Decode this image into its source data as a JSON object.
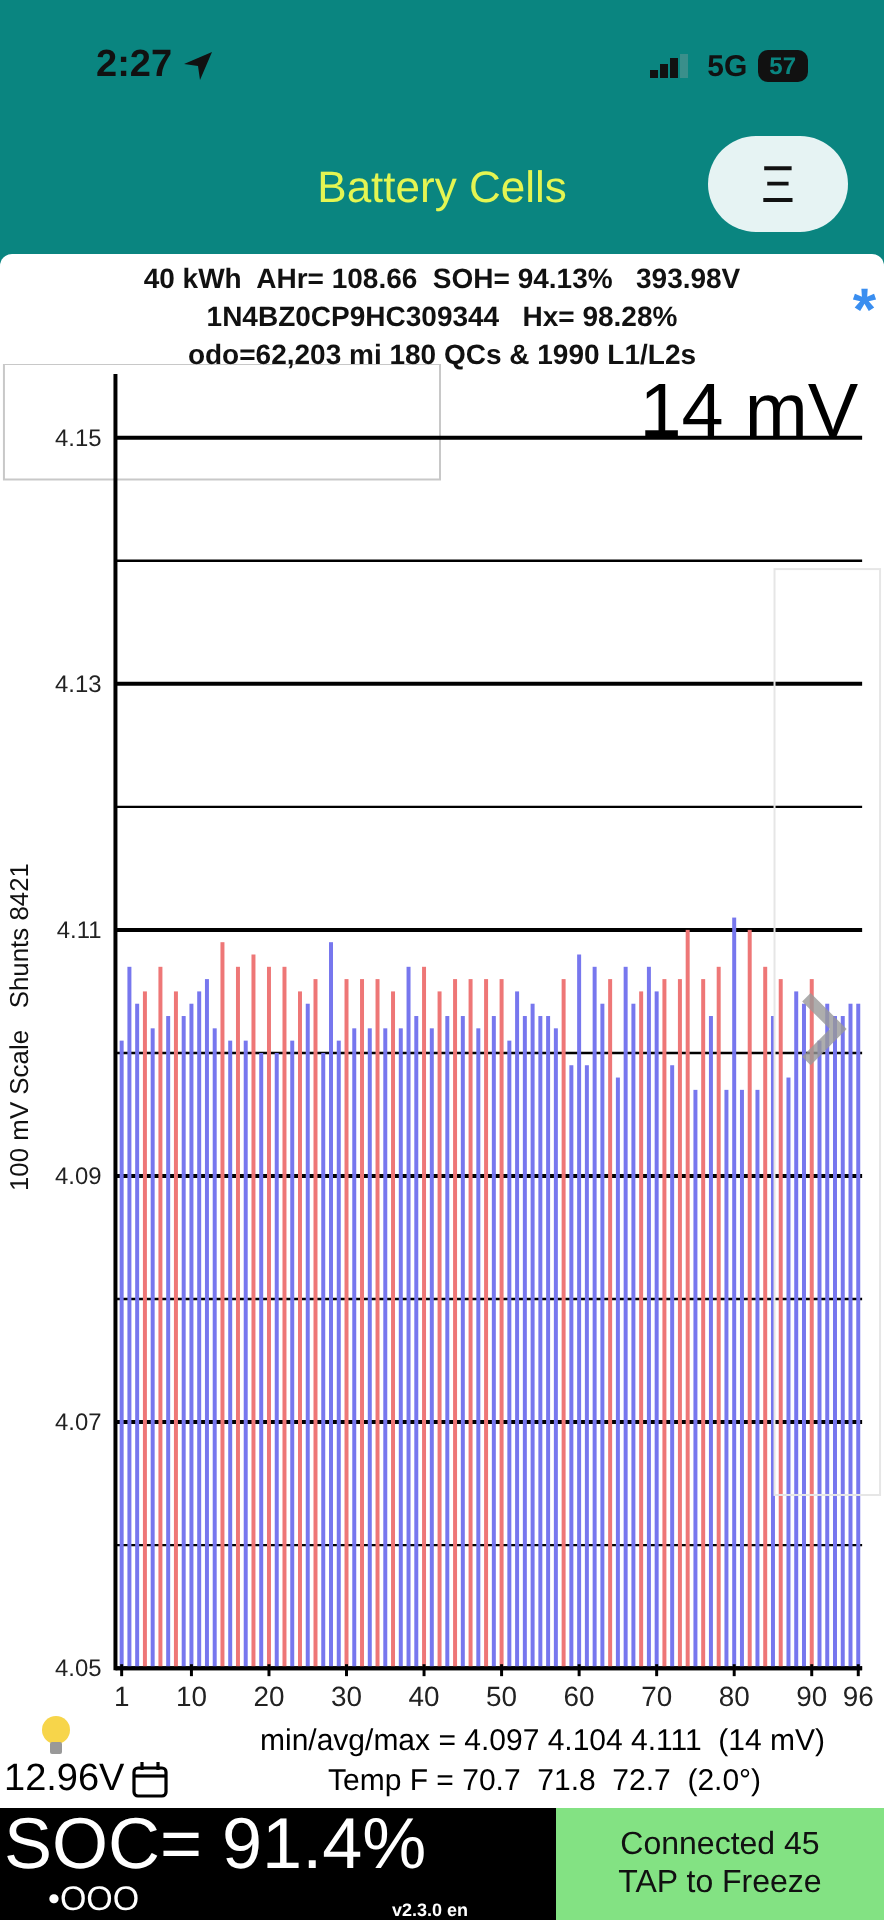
{
  "status_bar": {
    "time": "2:27",
    "network": "5G",
    "battery": "57"
  },
  "header": {
    "title": "Battery Cells",
    "menu": "Ξ"
  },
  "info": {
    "lines": [
      "40 kWh  AHr= 108.66  SOH= 94.13%   393.98V",
      "1N4BZ0CP9HC309344   Hx= 98.28%",
      "odo=62,203 mi 180 QCs & 1990 L1/L2s"
    ],
    "marker": "*"
  },
  "chart": {
    "spread_label": "14 mV",
    "chart_data": {
      "type": "bar",
      "grid": true,
      "xlim": [
        0.2,
        96.5
      ],
      "ylabel": "100 mV Scale   Shunts 8421",
      "x": [
        1,
        2,
        3,
        4,
        5,
        6,
        7,
        8,
        9,
        10,
        11,
        12,
        13,
        14,
        15,
        16,
        17,
        18,
        19,
        20,
        21,
        22,
        23,
        24,
        25,
        26,
        27,
        28,
        29,
        30,
        31,
        32,
        33,
        34,
        35,
        36,
        37,
        38,
        39,
        40,
        41,
        42,
        43,
        44,
        45,
        46,
        47,
        48,
        49,
        50,
        51,
        52,
        53,
        54,
        55,
        56,
        57,
        58,
        59,
        60,
        61,
        62,
        63,
        64,
        65,
        66,
        67,
        68,
        69,
        70,
        71,
        72,
        73,
        74,
        75,
        76,
        77,
        78,
        79,
        80,
        81,
        82,
        83,
        84,
        85,
        86,
        87,
        88,
        89,
        90,
        91,
        92,
        93,
        94,
        95,
        96
      ],
      "ylim": [
        4.05,
        4.15
      ],
      "yticks": [
        4.05,
        4.07,
        4.09,
        4.11,
        4.13,
        4.15
      ],
      "xticks": [
        1,
        10,
        20,
        30,
        40,
        50,
        60,
        70,
        80,
        90,
        96
      ],
      "series": [
        {
          "color": "#7777ee",
          "values": [
            4.101,
            4.107,
            4.104,
            null,
            4.102,
            null,
            4.103,
            null,
            4.103,
            4.104,
            4.105,
            4.106,
            4.102,
            null,
            4.101,
            null,
            4.101,
            null,
            4.1,
            null,
            4.1,
            null,
            4.101,
            null,
            4.104,
            null,
            4.1,
            4.109,
            4.101,
            null,
            4.102,
            null,
            4.102,
            null,
            4.102,
            null,
            4.102,
            4.107,
            4.103,
            null,
            4.102,
            null,
            4.103,
            null,
            4.103,
            null,
            4.102,
            null,
            4.103,
            null,
            4.101,
            4.105,
            4.103,
            4.104,
            4.103,
            4.103,
            4.102,
            null,
            4.099,
            4.108,
            4.099,
            4.107,
            4.104,
            null,
            4.098,
            4.107,
            4.104,
            null,
            4.107,
            4.105,
            null,
            4.099,
            null,
            null,
            4.097,
            null,
            4.103,
            null,
            4.097,
            4.111,
            4.097,
            null,
            4.097,
            null,
            4.103,
            null,
            4.098,
            4.105,
            4.104,
            null,
            4.101,
            4.104,
            4.103,
            4.103,
            4.104,
            4.104
          ]
        },
        {
          "color": "#ee7777",
          "values": [
            null,
            null,
            null,
            4.105,
            null,
            4.107,
            null,
            4.105,
            null,
            null,
            null,
            null,
            null,
            4.109,
            null,
            4.107,
            null,
            4.108,
            null,
            4.107,
            null,
            4.107,
            null,
            4.105,
            null,
            4.106,
            null,
            null,
            null,
            4.106,
            null,
            4.106,
            null,
            4.106,
            null,
            4.105,
            null,
            null,
            null,
            4.107,
            null,
            4.105,
            null,
            4.106,
            null,
            4.106,
            null,
            4.106,
            null,
            4.106,
            null,
            null,
            null,
            null,
            null,
            null,
            null,
            4.106,
            null,
            null,
            null,
            null,
            null,
            4.106,
            null,
            null,
            null,
            4.105,
            null,
            null,
            4.106,
            null,
            4.106,
            4.11,
            null,
            4.106,
            null,
            4.107,
            null,
            null,
            null,
            4.11,
            null,
            4.107,
            null,
            4.106,
            null,
            null,
            null,
            4.106,
            null,
            null,
            null,
            null,
            null,
            null
          ]
        }
      ]
    }
  },
  "summary": {
    "voltage": "12.96V",
    "lines": [
      "min/avg/max = 4.097 4.104 4.111  (14 mV)",
      "Temp F = 70.7  71.8  72.7  (2.0°)"
    ]
  },
  "footer": {
    "soc": "SOC= 91.4%",
    "indicator": "•OOO",
    "version": "v2.3.0 en",
    "connection": [
      "Connected 45",
      "TAP to Freeze"
    ]
  }
}
